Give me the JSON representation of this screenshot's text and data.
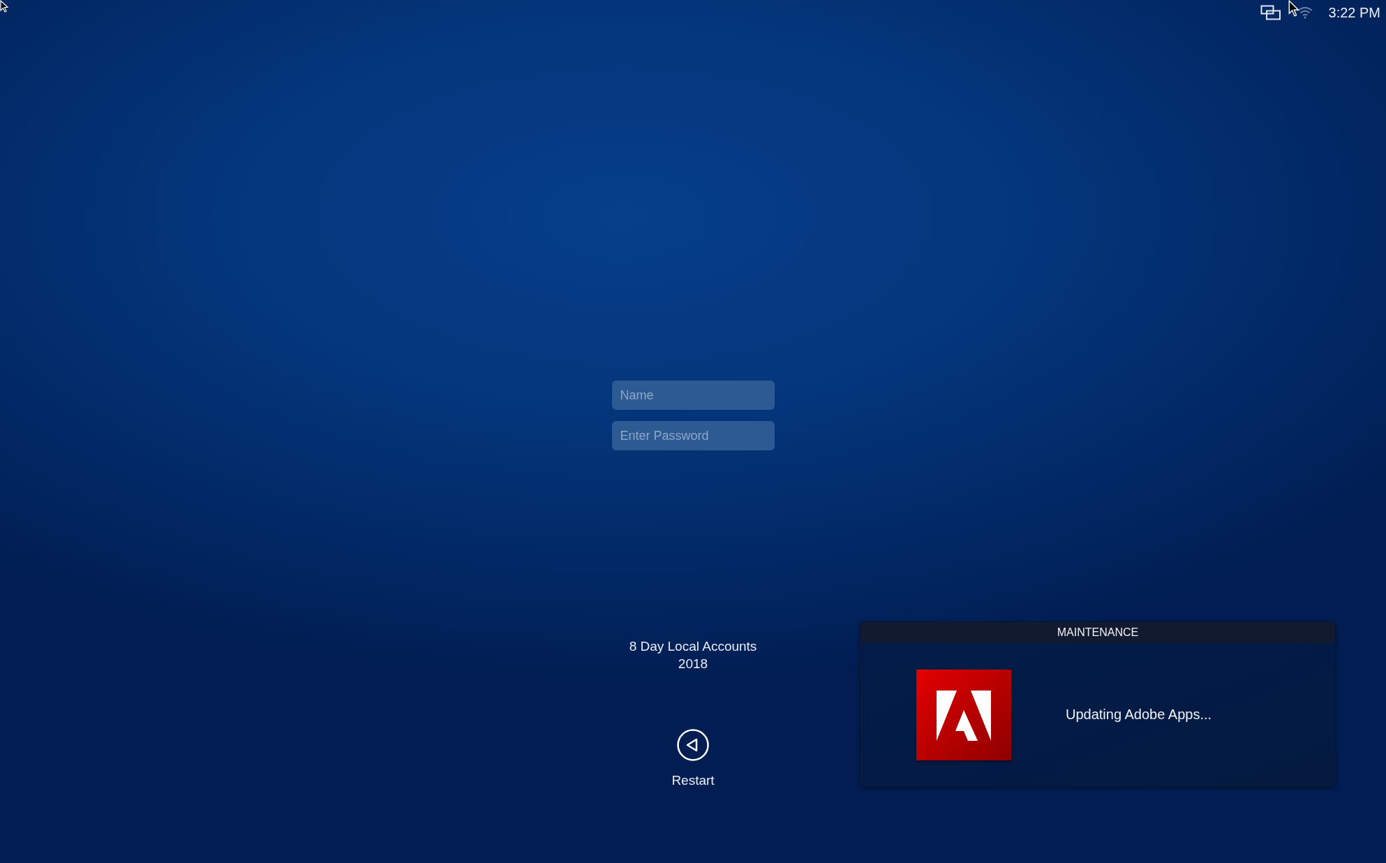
{
  "menu_bar": {
    "clock": "3:22 PM"
  },
  "login": {
    "fields": [
      {
        "placeholder": "Name"
      },
      {
        "placeholder": "Enter Password"
      }
    ],
    "message": [
      "8 Day Local Accounts",
      "2018"
    ],
    "actions": [
      {
        "kind": "restart",
        "label": "Restart"
      }
    ]
  },
  "notification": {
    "title": "MAINTENANCE",
    "text": "Updating Adobe Apps..."
  }
}
